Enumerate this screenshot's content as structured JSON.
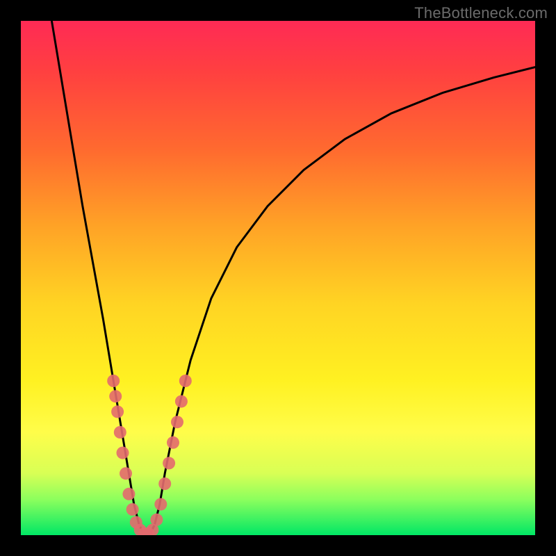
{
  "watermark": "TheBottleneck.com",
  "chart_data": {
    "type": "line",
    "title": "",
    "xlabel": "",
    "ylabel": "",
    "xlim": [
      0,
      100
    ],
    "ylim": [
      0,
      100
    ],
    "grid": false,
    "legend": false,
    "annotations": [],
    "series": [
      {
        "name": "curve",
        "x": [
          6,
          8,
          10,
          12,
          14,
          16,
          18,
          19,
          20,
          21,
          22,
          23,
          24,
          25,
          26,
          27,
          28,
          30,
          33,
          37,
          42,
          48,
          55,
          63,
          72,
          82,
          92,
          100
        ],
        "y": [
          100,
          88,
          76,
          64,
          53,
          42,
          30,
          24,
          18,
          12,
          6,
          2,
          0,
          0,
          2,
          6,
          12,
          22,
          34,
          46,
          56,
          64,
          71,
          77,
          82,
          86,
          89,
          91
        ]
      }
    ],
    "markers": {
      "name": "dots",
      "color": "#e36a6e",
      "points": [
        {
          "x": 18.0,
          "y": 30
        },
        {
          "x": 18.4,
          "y": 27
        },
        {
          "x": 18.8,
          "y": 24
        },
        {
          "x": 19.3,
          "y": 20
        },
        {
          "x": 19.8,
          "y": 16
        },
        {
          "x": 20.4,
          "y": 12
        },
        {
          "x": 21.0,
          "y": 8
        },
        {
          "x": 21.7,
          "y": 5
        },
        {
          "x": 22.4,
          "y": 2.5
        },
        {
          "x": 23.2,
          "y": 1
        },
        {
          "x": 24.0,
          "y": 0.3
        },
        {
          "x": 24.8,
          "y": 0.3
        },
        {
          "x": 25.6,
          "y": 1
        },
        {
          "x": 26.4,
          "y": 3
        },
        {
          "x": 27.2,
          "y": 6
        },
        {
          "x": 28.0,
          "y": 10
        },
        {
          "x": 28.8,
          "y": 14
        },
        {
          "x": 29.6,
          "y": 18
        },
        {
          "x": 30.4,
          "y": 22
        },
        {
          "x": 31.2,
          "y": 26
        },
        {
          "x": 32.0,
          "y": 30
        }
      ]
    }
  }
}
